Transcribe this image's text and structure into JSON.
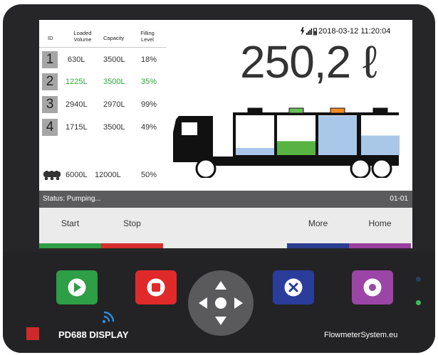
{
  "table": {
    "headers": {
      "id": "ID",
      "loaded_volume": "Loaded\nVolume",
      "capacity": "Capacity",
      "filling_level": "Filling\nLevel"
    },
    "rows": [
      {
        "id": "1",
        "loaded": "630L",
        "capacity": "3500L",
        "level": "18%",
        "active": false
      },
      {
        "id": "2",
        "loaded": "1225L",
        "capacity": "3500L",
        "level": "35%",
        "active": true
      },
      {
        "id": "3",
        "loaded": "2940L",
        "capacity": "2970L",
        "level": "99%",
        "active": false
      },
      {
        "id": "4",
        "loaded": "1715L",
        "capacity": "3500L",
        "level": "49%",
        "active": false
      }
    ],
    "total": {
      "icon": "tanker-icon",
      "loaded": "6000L",
      "capacity": "12000L",
      "level": "50%"
    }
  },
  "status_icons": {
    "icons": [
      "lightning-icon",
      "signal-icon",
      "battery-icon"
    ]
  },
  "datetime": "2018-03-12 11:20:04",
  "volume_display": "250,2 ℓ",
  "truck": {
    "compartment_levels": [
      0.18,
      0.35,
      0.99,
      0.49
    ],
    "compartment_fill_colors": [
      "#a9c7e8",
      "#58b343",
      "#a9c7e8",
      "#a9c7e8"
    ],
    "indicator_colors": [
      "#111111",
      "#6bc15a",
      "#f28c28",
      "#111111"
    ]
  },
  "status_bar": {
    "status": "Status: Pumping...",
    "page": "01-01"
  },
  "function_keys": [
    {
      "label": "Start",
      "color": "#2e9e47"
    },
    {
      "label": "Stop",
      "color": "#d42e2e"
    },
    {
      "label": "",
      "color": "#ebebeb"
    },
    {
      "label": "",
      "color": "#ebebeb"
    },
    {
      "label": "More",
      "color": "#2b3d8f"
    },
    {
      "label": "Home",
      "color": "#9b3fa0"
    }
  ],
  "hardware_buttons": {
    "start": {
      "color": "#2e9e47",
      "icon": "play-icon"
    },
    "stop": {
      "color": "#e02a2a",
      "icon": "stop-icon"
    },
    "more": {
      "color": "#2b3d9a",
      "icon": "x-icon"
    },
    "home": {
      "color": "#9b45a6",
      "icon": "circle-icon"
    }
  },
  "leds": {
    "top": "#2a3f66",
    "bottom": "#3bbf5a"
  },
  "branding": {
    "model": "PD688 DISPLAY",
    "maker": "FlowmeterSystem.eu"
  }
}
